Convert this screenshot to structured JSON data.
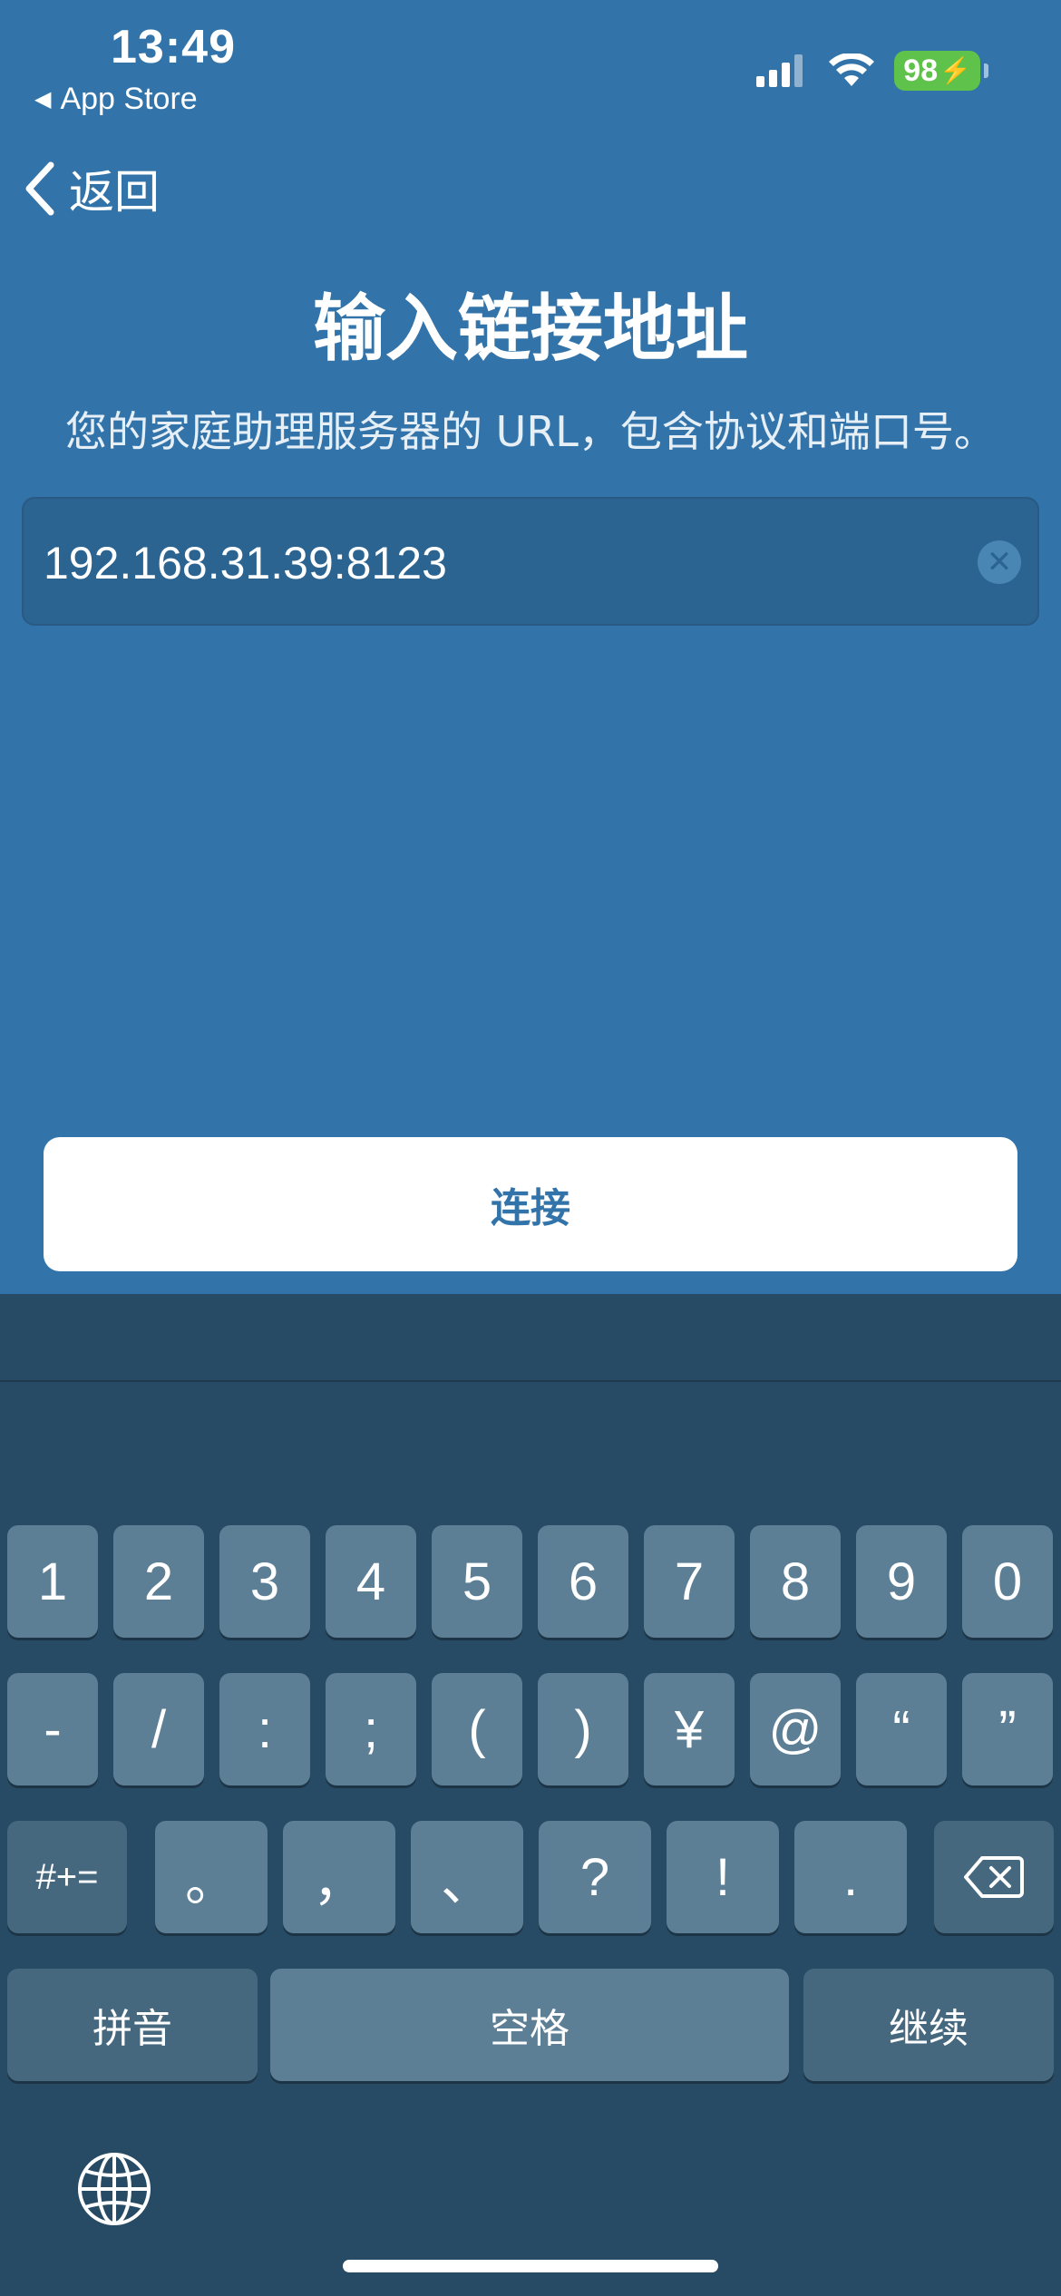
{
  "status_bar": {
    "time": "13:49",
    "back_app": "App Store",
    "battery": "98"
  },
  "nav": {
    "back_label": "返回"
  },
  "page": {
    "title": "输入链接地址",
    "subtitle": "您的家庭助理服务器的 URL，包含协议和端口号。"
  },
  "url_field": {
    "value": "192.168.31.39:8123"
  },
  "connect_button": {
    "label": "连接"
  },
  "keyboard": {
    "row1": [
      "1",
      "2",
      "3",
      "4",
      "5",
      "6",
      "7",
      "8",
      "9",
      "0"
    ],
    "row2": [
      "-",
      "/",
      ":",
      ";",
      "(",
      ")",
      "¥",
      "@",
      "“",
      "”"
    ],
    "row3_mode": "#+=",
    "row3": [
      "。",
      "，",
      "、",
      "?",
      "!",
      "."
    ],
    "pinyin": "拼音",
    "space": "空格",
    "continue": "继续"
  },
  "colors": {
    "app_background": "#3274a9",
    "keyboard_background": "#274b64",
    "key": "#5d7f96",
    "battery": "#5fc24a"
  }
}
